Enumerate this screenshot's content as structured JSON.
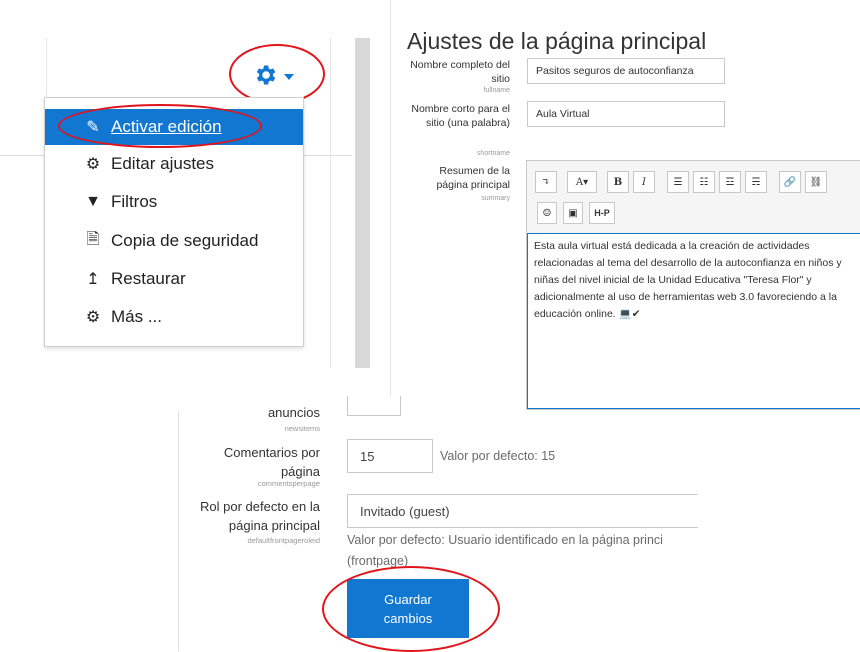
{
  "menu": {
    "items": [
      {
        "label": "Activar edición",
        "icon": "pencil-icon"
      },
      {
        "label": "Editar ajustes",
        "icon": "gear-icon"
      },
      {
        "label": "Filtros",
        "icon": "filter-icon"
      },
      {
        "label": "Copia de seguridad",
        "icon": "file-icon"
      },
      {
        "label": "Restaurar",
        "icon": "upload-icon"
      },
      {
        "label": "Más ...",
        "icon": "gear-icon"
      }
    ]
  },
  "settings": {
    "title": "Ajustes de la página principal",
    "fullname": {
      "label": "Nombre completo del sitio",
      "key": "fullname",
      "value": "Pasitos seguros de autoconfianza"
    },
    "shortname": {
      "label": "Nombre corto para el sitio (una palabra)",
      "key": "shortname",
      "value": "Aula Virtual"
    },
    "summary": {
      "label": "Resumen de la página principal",
      "key": "summary",
      "text": "Esta aula virtual está dedicada a la creación de actividades relacionadas al tema del desarrollo de la autoconfianza en niños y niñas del nivel inicial de la Unidad Educativa \"Teresa Flor\" y adicionalmente al uso de herramientas web 3.0 favoreciendo a la educación online. 💻✔"
    },
    "toolbar": [
      "↴",
      "A▾",
      "B",
      "I",
      "☰",
      "☷",
      "☲",
      "☴",
      "🔗",
      "⛓",
      "☺",
      "▣",
      "H-P"
    ]
  },
  "bottom": {
    "newsitems": {
      "label": "anuncios",
      "key": "newsitems"
    },
    "comments": {
      "label": "Comentarios por página",
      "key": "commentsperpage",
      "value": "15",
      "hint": "Valor por defecto: 15"
    },
    "role": {
      "label": "Rol por defecto en la página principal",
      "key": "defaultfrontpageroleid",
      "value": "Invitado (guest)",
      "hint1": "Valor por defecto: Usuario identificado en la página princi",
      "hint2": "(frontpage)"
    },
    "save_line1": "Guardar",
    "save_line2": "cambios"
  },
  "colors": {
    "accent": "#1177d1",
    "highlight_ring": "#e0141a"
  }
}
